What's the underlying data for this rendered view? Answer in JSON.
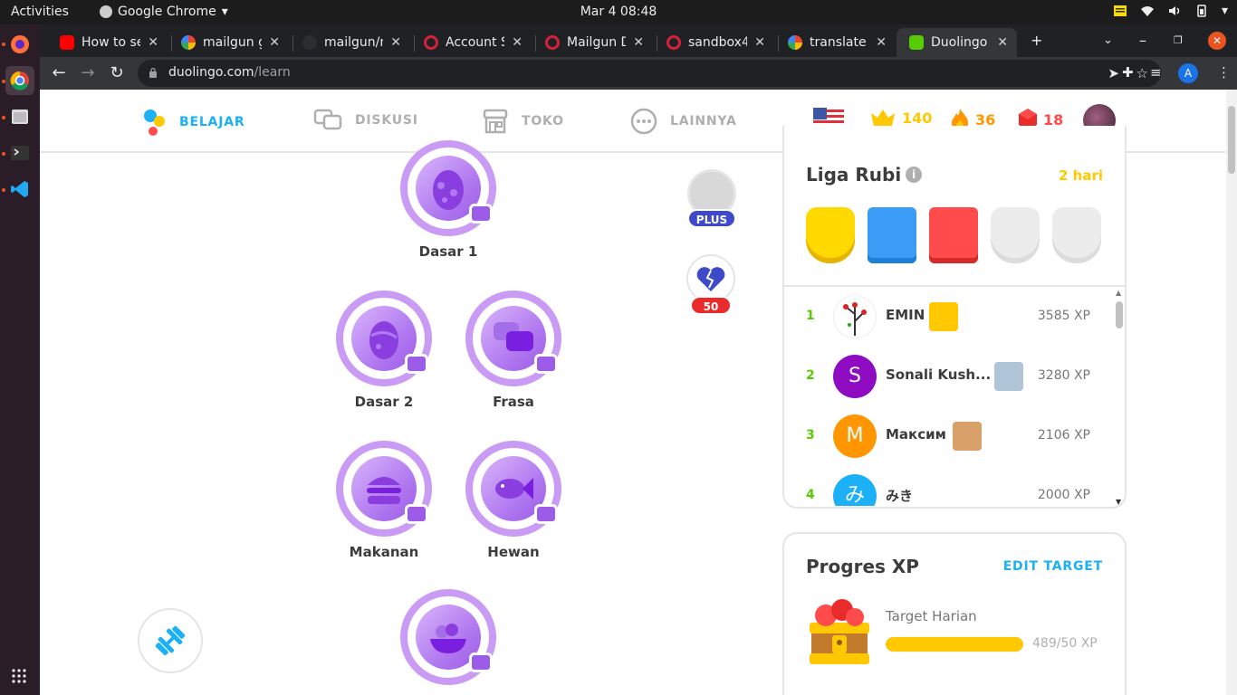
{
  "os": {
    "activities": "Activities",
    "app_name": "Google Chrome",
    "clock": "Mar 4  08:48"
  },
  "browser": {
    "tabs": [
      {
        "title": "How to se",
        "favicon_color": "#ff0000"
      },
      {
        "title": "mailgun g",
        "favicon_color": "#4285f4"
      },
      {
        "title": "mailgun/n",
        "favicon_color": "#24292e"
      },
      {
        "title": "Account S",
        "favicon_color": "#d4213b"
      },
      {
        "title": "Mailgun D",
        "favicon_color": "#d4213b"
      },
      {
        "title": "sandbox4",
        "favicon_color": "#d4213b"
      },
      {
        "title": "translate -",
        "favicon_color": "#4285f4"
      },
      {
        "title": "Duolingo",
        "favicon_color": "#58cc02"
      }
    ],
    "url_host": "duolingo.com",
    "url_path": "/learn",
    "profile_initial": "A"
  },
  "nav": {
    "items": [
      {
        "label": "BELAJAR",
        "active": true
      },
      {
        "label": "DISKUSI",
        "active": false
      },
      {
        "label": "TOKO",
        "active": false
      },
      {
        "label": "LAINNYA",
        "active": false
      }
    ],
    "crowns": "140",
    "streak": "36",
    "gems": "18"
  },
  "skills": [
    {
      "label": "Dasar 1"
    },
    {
      "label": "Dasar 2"
    },
    {
      "label": "Frasa"
    },
    {
      "label": "Makanan"
    },
    {
      "label": "Hewan"
    },
    {
      "label": ""
    }
  ],
  "plus_label": "PLUS",
  "hearts_count": "50",
  "league": {
    "title": "Liga Rubi",
    "info": "i",
    "days_left": "2 hari",
    "entries": [
      {
        "rank": "1",
        "initial": "",
        "name": "EMIN",
        "xp": "3585 XP",
        "avatar_color": "#ffffff"
      },
      {
        "rank": "2",
        "initial": "S",
        "name": "Sonali Kush...",
        "xp": "3280 XP",
        "avatar_color": "#8e0bc2"
      },
      {
        "rank": "3",
        "initial": "M",
        "name": "Максим",
        "xp": "2106 XP",
        "avatar_color": "#ff9600"
      },
      {
        "rank": "4",
        "initial": "み",
        "name": "みき",
        "xp": "2000 XP",
        "avatar_color": "#1cb0f6"
      }
    ]
  },
  "progress": {
    "title": "Progres XP",
    "edit": "EDIT TARGET",
    "target_label": "Target Harian",
    "count": "489/50 XP",
    "fill_fraction": 1
  },
  "colors": {
    "accent": "#1cb0f6",
    "skill": "#c99bf5",
    "gold": "#ffc800",
    "streak": "#ff9600",
    "gem": "#ff4b4b",
    "rank": "#58cc02"
  }
}
